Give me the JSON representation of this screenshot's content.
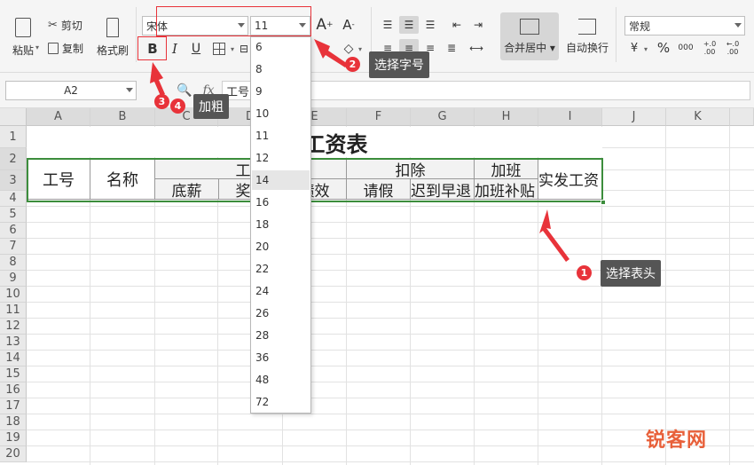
{
  "ribbon": {
    "paste": "粘贴",
    "cut": "剪切",
    "copy": "复制",
    "format_painter": "格式刷",
    "font_name": "宋体",
    "font_size": "11",
    "bold": "B",
    "italic": "I",
    "underline": "U",
    "merge_center": "合并居中",
    "wrap_text": "自动换行",
    "number_format": "常规",
    "percent": "%",
    "thousands": "000",
    "inc_decimal": "+.0\n.00",
    "dec_decimal": "←.0\n.00"
  },
  "formula_bar": {
    "name_box": "A2",
    "fx": "fx",
    "content": "工号"
  },
  "columns": [
    "A",
    "B",
    "C",
    "D",
    "E",
    "F",
    "G",
    "H",
    "I",
    "J",
    "K"
  ],
  "rows": [
    "1",
    "2",
    "3",
    "4",
    "5",
    "6",
    "7",
    "8",
    "9",
    "10",
    "11",
    "12",
    "13",
    "14",
    "15",
    "16",
    "17",
    "18",
    "19",
    "20"
  ],
  "sheet": {
    "title": "技术工资表",
    "h_id": "工号",
    "h_name": "名称",
    "h_salary": "工资",
    "h_base": "底薪",
    "h_bonus": "奖金",
    "h_perf": "绩效",
    "h_deduct": "扣除",
    "h_leave": "请假",
    "h_late": "迟到早退",
    "h_overtime": "加班",
    "h_ot_pay": "加班补贴",
    "h_actual": "实发工资"
  },
  "font_sizes": [
    "6",
    "8",
    "9",
    "10",
    "11",
    "12",
    "14",
    "16",
    "18",
    "20",
    "22",
    "24",
    "26",
    "28",
    "36",
    "48",
    "72"
  ],
  "highlighted_size": "14",
  "callouts": {
    "c1": "选择表头",
    "c2": "选择字号",
    "c4": "加粗",
    "n1": "1",
    "n2": "2",
    "n3": "3",
    "n4": "4"
  },
  "watermark": "锐客网",
  "colors": {
    "accent_red": "#e8333a",
    "selection_green": "#3c8d3c",
    "callout_bg": "#555555"
  }
}
